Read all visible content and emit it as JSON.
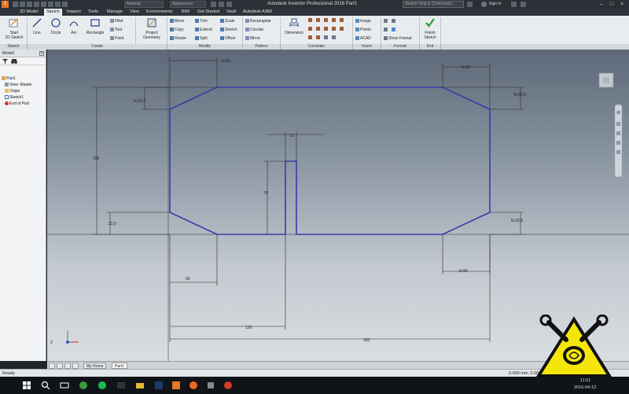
{
  "titlebar": {
    "app_letter": "I",
    "material_placeholder": "Material",
    "appearance_placeholder": "Appearance",
    "title": "Autodesk Inventor Professional 2016   Part1",
    "search_placeholder": "Search Help & Commands...",
    "sign_in": "Sign In"
  },
  "tabs": [
    "3D Model",
    "Sketch",
    "Inspect",
    "Tools",
    "Manage",
    "View",
    "Environments",
    "BIM",
    "Get Started",
    "Vault",
    "Autodesk A360"
  ],
  "ribbon": {
    "start_sketch": "Start\n2D Sketch",
    "line": "Line",
    "circle": "Circle",
    "arc": "Arc",
    "rectangle": "Rectangle",
    "fillet": "Fillet",
    "text": "Text",
    "point": "Point",
    "project_geometry": "Project Geometry",
    "move": "Move",
    "copy": "Copy",
    "rotate": "Rotate",
    "trim": "Trim",
    "extend": "Extend",
    "split": "Split",
    "scale": "Scale",
    "stretch": "Stretch",
    "offset": "Offset",
    "rect_pattern": "Rectangular",
    "circular": "Circular",
    "mirror": "Mirror",
    "dimension": "Dimension",
    "image": "Image",
    "points": "Points",
    "acad": "ACAD",
    "show_format": "Show Format",
    "finish_sketch": "Finish Sketch",
    "groups": {
      "sketch": "Sketch",
      "create": "Create",
      "modify": "Modify",
      "pattern": "Pattern",
      "constrain": "Constrain",
      "insert": "Insert",
      "format": "Format",
      "exit": "Exit"
    }
  },
  "browser": {
    "header": "Model",
    "nodes": [
      "Part1",
      "View: Master",
      "Origin",
      "Sketch1",
      "End of Part"
    ]
  },
  "sketch": {
    "dims": {
      "top_chamfer_left": "fx:50",
      "top_chamfer_right": "fx:50",
      "chamfer_v_tl": "fx:22,5",
      "chamfer_v_tr": "fx:22,5",
      "height": "150",
      "chamfer_v_bl": "22,5",
      "chamfer_v_br": "fx:22,5",
      "bottom_left": "50",
      "bottom_right": "fx:50",
      "slot_width": "12",
      "slot_height": "75",
      "to_slot": "120",
      "total_width": "330"
    },
    "colors": {
      "outline": "#3a3aa8",
      "dim": "#2a2a2a"
    }
  },
  "doctabs": {
    "home": "My Home",
    "part": "Part1"
  },
  "status": {
    "ready": "Ready",
    "coords": "0.000 mm, 0.000 mm"
  },
  "taskbar": {
    "time": "11:51",
    "date": "2016-04-12"
  }
}
